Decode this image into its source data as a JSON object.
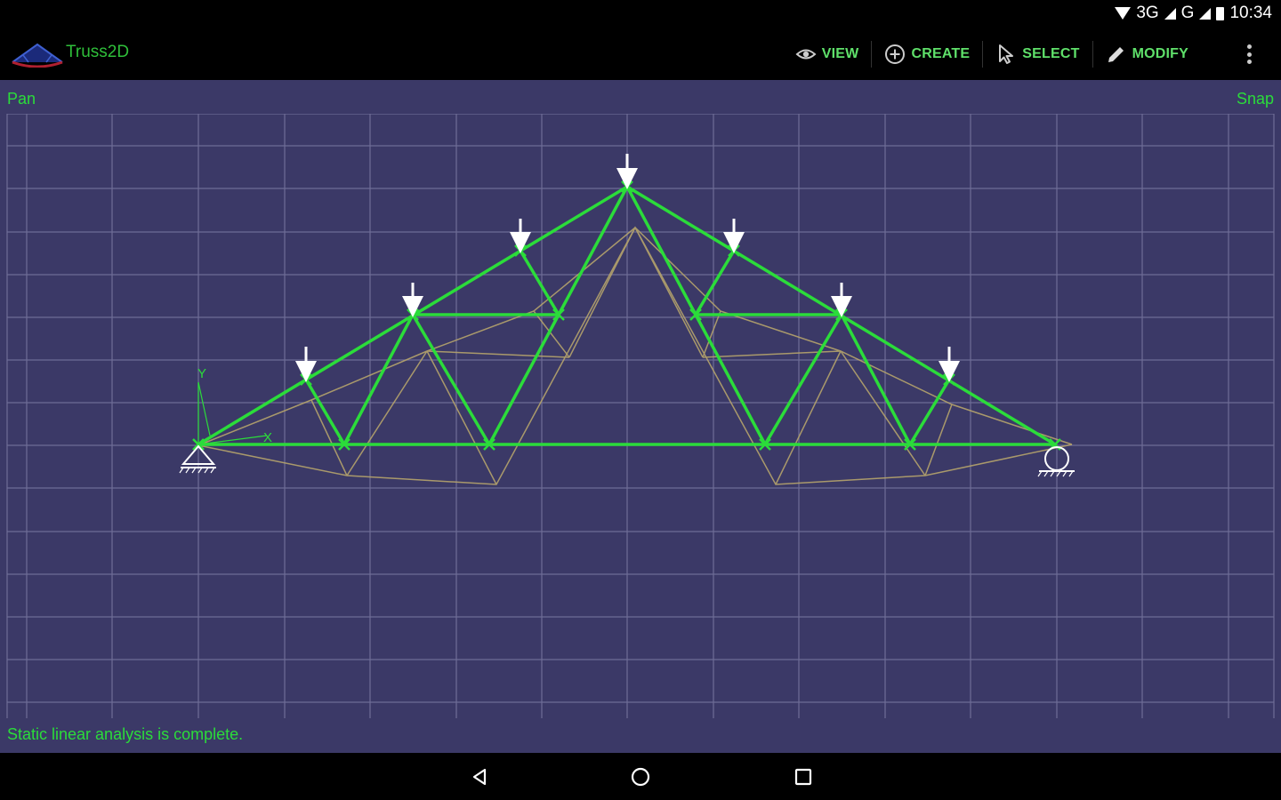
{
  "status_bar": {
    "network": "3G",
    "network2": "G",
    "time": "10:34"
  },
  "app": {
    "title": "Truss2D"
  },
  "actions": [
    {
      "label": "VIEW",
      "icon": "eye-icon"
    },
    {
      "label": "CREATE",
      "icon": "add-circle-icon"
    },
    {
      "label": "SELECT",
      "icon": "cursor-icon"
    },
    {
      "label": "MODIFY",
      "icon": "pencil-icon"
    }
  ],
  "toolbar": {
    "mode": "Pan",
    "snap": "Snap"
  },
  "axes": {
    "x": "X",
    "y": "Y"
  },
  "status": {
    "message": "Static linear analysis is complete."
  },
  "nav": {
    "back": "back-icon",
    "home": "home-icon",
    "recents": "recents-icon"
  },
  "colors": {
    "canvas_bg": "#3b3967",
    "grid": "#6e6d96",
    "member": "#2bdc3a",
    "deformed": "#b6a46c",
    "load": "#ffffff"
  }
}
